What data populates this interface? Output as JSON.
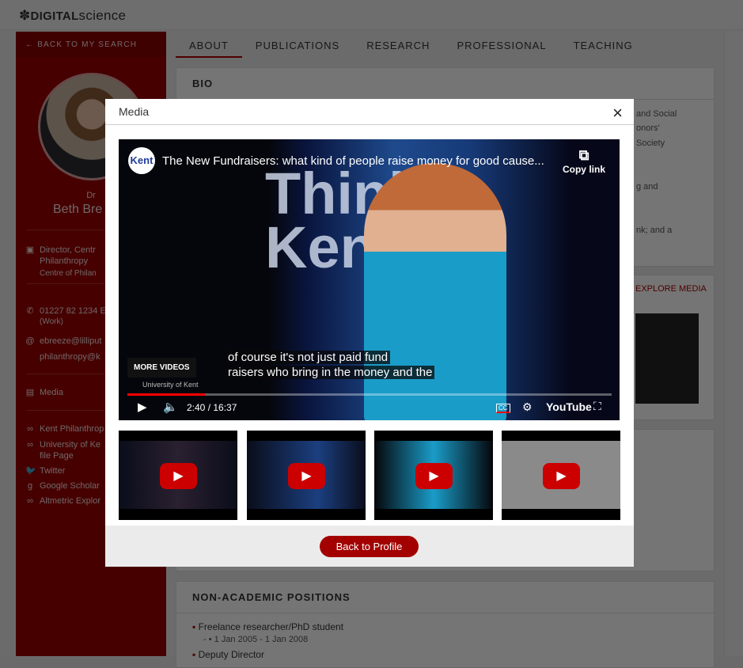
{
  "header": {
    "logo_bold": "DIGITAL",
    "logo_light": "science"
  },
  "sidebar": {
    "back": "BACK TO MY SEARCH",
    "title": "Dr",
    "name": "Beth Bre",
    "position": [
      "Director, Centr",
      "Philanthropy",
      "Centre of Philan"
    ],
    "phone": [
      "01227 82 1234 E",
      "(Work)"
    ],
    "emails": [
      "ebreeze@lilliput",
      "philanthropy@k"
    ],
    "media": "Media",
    "links": [
      "Kent Philanthrop",
      "University of Ke",
      "file Page",
      "Twitter",
      "Google Scholar",
      "Altmetric Explor"
    ]
  },
  "tabs": [
    "ABOUT",
    "PUBLICATIONS",
    "RESEARCH",
    "PROFESSIONAL",
    "TEACHING"
  ],
  "bio": {
    "heading": "BIO",
    "fragments": [
      "and Social",
      "onors'",
      "Society",
      "g and",
      "nk; and a"
    ]
  },
  "explore": {
    "heading": "EXPLORE MEDIA"
  },
  "nonacademic": {
    "heading": "NON-ACADEMIC POSITIONS",
    "items": [
      {
        "title": "Freelance researcher/PhD student",
        "dates": "1 Jan 2005 - 1 Jan 2008"
      },
      {
        "title": "Deputy Director"
      }
    ]
  },
  "modal": {
    "title": "Media",
    "close": "×",
    "video": {
      "channel": "Kent",
      "title": "The New Fundraisers: what kind of people raise money for good cause...",
      "copy_link": "Copy link",
      "more_videos": "MORE VIDEOS",
      "caption": [
        "of course it's not just paid fund",
        "raisers who bring in the money and the"
      ],
      "time": "2:40 / 16:37",
      "progress": 0.16,
      "brand": "YouTube",
      "cc": "CC",
      "watermark": "University of Kent"
    },
    "thumbnails": 4,
    "back_button": "Back to Profile"
  }
}
